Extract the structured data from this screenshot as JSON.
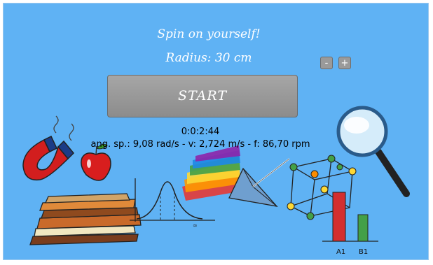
{
  "header": {
    "title": "Spin on yourself!",
    "radius_label": "Radius: 30 cm"
  },
  "radius_controls": {
    "decrease_label": "-",
    "increase_label": "+"
  },
  "start_button": {
    "label": "START"
  },
  "readout": {
    "timer": "0:0:2:44",
    "stats": "ang. sp.: 9,08 rad/s - v: 2,724 m/s - f: 86,70 rpm"
  },
  "illustration": {
    "bar_labels": [
      "A1",
      "B1"
    ],
    "curve_label": "∞",
    "icons": [
      "magnet-icon",
      "apple-icon",
      "books-icon",
      "bell-curve-icon",
      "prism-icon",
      "cube-structure-icon",
      "bar-chart-icon",
      "magnifier-icon"
    ]
  },
  "colors": {
    "background": "#5fb2f4",
    "button": "#999999",
    "text_light": "#ffffff"
  }
}
